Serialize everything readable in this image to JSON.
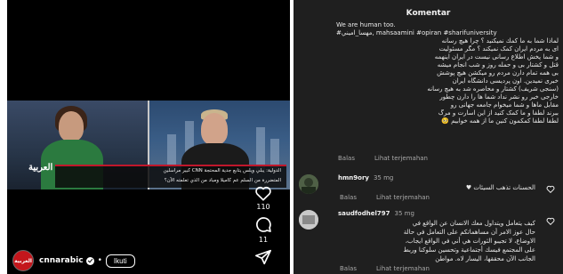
{
  "reel": {
    "channel_logo": "العربية",
    "chyron_lines": [
      "كبير مراسلين CNN الدولية: يبلي ويلس يتابع جدية المحتجة",
      "المتضررة من السلم عم كاميلا ومباد من الذي تعلمته الآن؟"
    ],
    "actions": {
      "like_count": "110",
      "comment_count": "11"
    },
    "author": {
      "avatar_text": "العربية",
      "handle": "cnnarabic",
      "separator": "•",
      "follow_label": "Ikuti"
    }
  },
  "panel": {
    "title": "Komentar",
    "caption_lines": [
      "We are human too.",
      "#مهسا_اميني, mahsaamini #opiran #sharifuniversity",
      "لماذا شما به ما كمك نميكنيد ؟ چرا هيچ رسانه",
      "ای به مردم ایران کمک نمیکند ؟ مگر مسئولیت",
      "و شما پخش اطلاع رسانی نیست در ایران اینهمه",
      "قتل و کشتار بی و حمله روز و شب انجام میشه",
      "بی همه تمام دارن مردم رو میکشن هیچ پوشش",
      "خبری نمیدین. اون پردیسی دانشگاه ایران",
      "(سنجی شریف) کشتار و محاصره شد به هیچ رسانه",
      "خارجی خبر رو نشر نداد شما ها را دارن چطور",
      "مقابل ماها و شما میخوام جامعه جهانی رو",
      "ببرند لطفا و ما کمک کنید از این اسارت و مرگ",
      "لطفا لطفا کمکمون کنین ما از همه خوابیم 🥺"
    ],
    "caption_foot": {
      "time": "Balas",
      "translate": "Lihat terjemahan"
    },
    "comments": [
      {
        "user": "hmn9ory",
        "time": "35 mg",
        "body": [
          "الحسنات تذهب السيئات ♥"
        ],
        "reply": "Balas",
        "translate": "Lihat terjemahan"
      },
      {
        "user": "saudfodhel797",
        "time": "35 mg",
        "body": [
          "كيف يتعامل ويتداول معك الانسان عن الواقع في",
          "حال عوز الامر أن مساهماتكم على التعامل في حالة",
          "الاوضاع، لا تجيبو الثورات هي أني في الواقع ايجاب،",
          "على المجتمع فيسك أجتماعية وتحسين سلوكنا وربط",
          "الجانب الآن محققها، اليسار لاه. مواطن"
        ],
        "reply": "Balas",
        "translate": "Lihat terjemahan"
      }
    ]
  }
}
